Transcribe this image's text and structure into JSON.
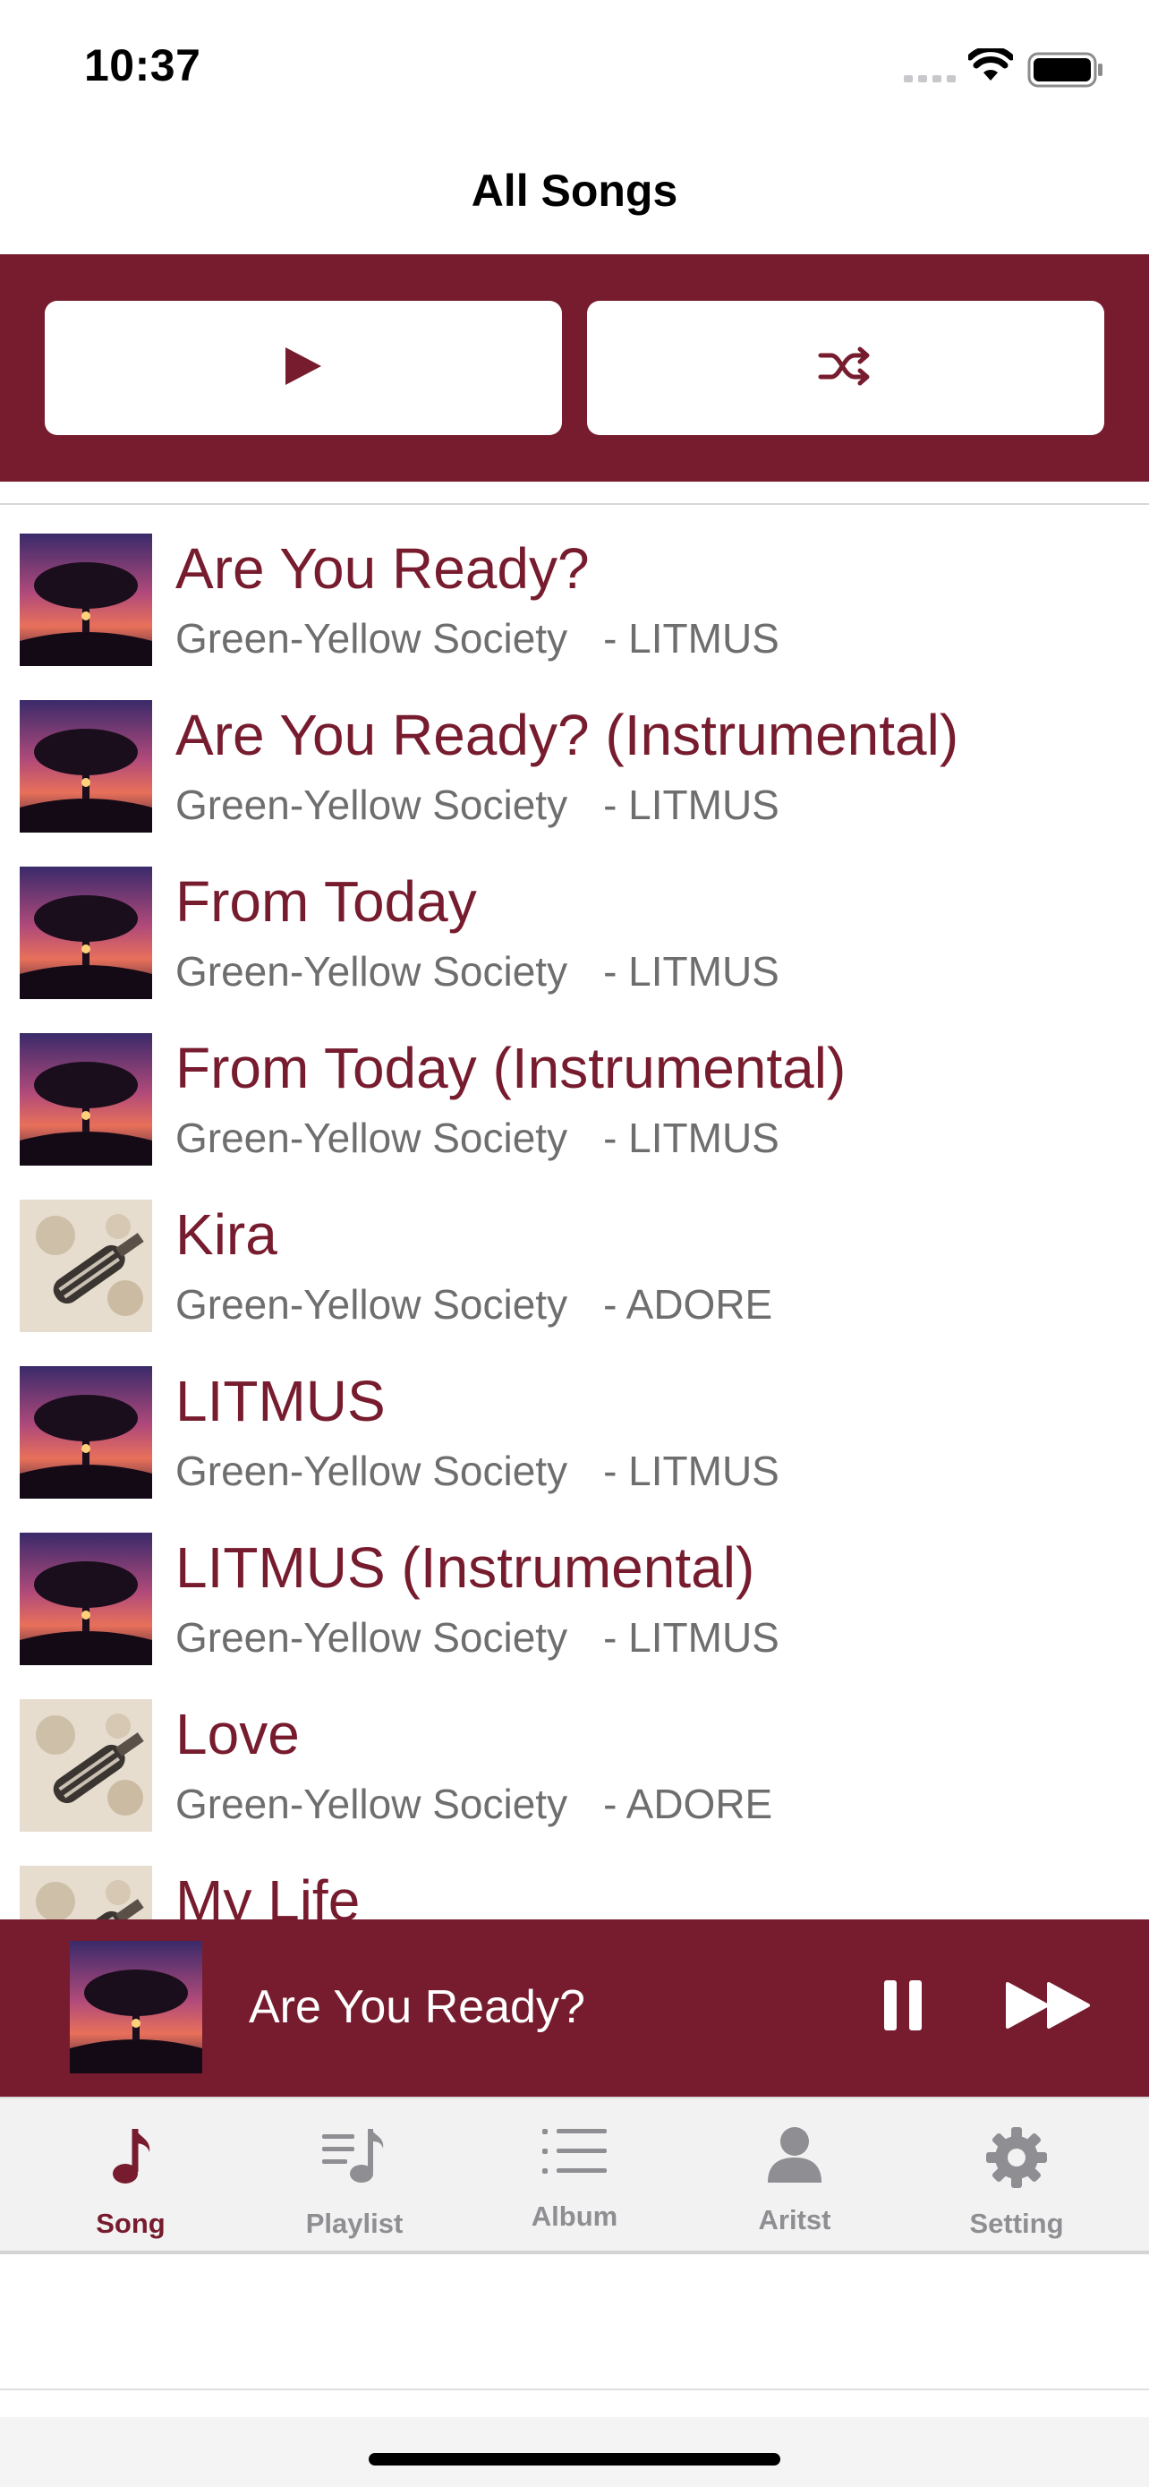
{
  "status_bar": {
    "time": "10:37"
  },
  "header": {
    "title": "All Songs"
  },
  "actions": {
    "play_icon": "play-icon",
    "shuffle_icon": "shuffle-icon"
  },
  "songs": [
    {
      "title": "Are You Ready?",
      "artist": "Green-Yellow Society",
      "album": "- LITMUS",
      "art": "tree-sunset"
    },
    {
      "title": "Are You Ready? (Instrumental)",
      "artist": "Green-Yellow Society",
      "album": "- LITMUS",
      "art": "tree-sunset"
    },
    {
      "title": "From Today",
      "artist": "Green-Yellow Society",
      "album": "- LITMUS",
      "art": "tree-sunset"
    },
    {
      "title": "From Today (Instrumental)",
      "artist": "Green-Yellow Society",
      "album": "- LITMUS",
      "art": "tree-sunset"
    },
    {
      "title": "Kira",
      "artist": "Green-Yellow Society",
      "album": "- ADORE",
      "art": "guitar-splash"
    },
    {
      "title": "LITMUS",
      "artist": "Green-Yellow Society",
      "album": "- LITMUS",
      "art": "tree-sunset"
    },
    {
      "title": "LITMUS (Instrumental)",
      "artist": "Green-Yellow Society",
      "album": "- LITMUS",
      "art": "tree-sunset"
    },
    {
      "title": "Love",
      "artist": "Green-Yellow Society",
      "album": "- ADORE",
      "art": "guitar-splash"
    },
    {
      "title": "My Life",
      "artist": "",
      "album": "",
      "art": "guitar-splash"
    }
  ],
  "now_playing": {
    "title": "Are You Ready?"
  },
  "tabs": [
    {
      "label": "Song",
      "icon": "music-note-icon",
      "active": true
    },
    {
      "label": "Playlist",
      "icon": "playlist-icon",
      "active": false
    },
    {
      "label": "Album",
      "icon": "list-icon",
      "active": false
    },
    {
      "label": "Aritst",
      "icon": "person-icon",
      "active": false
    },
    {
      "label": "Setting",
      "icon": "gear-icon",
      "active": false
    }
  ],
  "colors": {
    "accent": "#771c2e",
    "tab_inactive": "#8e8e93",
    "subtitle": "#6e6e6e"
  }
}
